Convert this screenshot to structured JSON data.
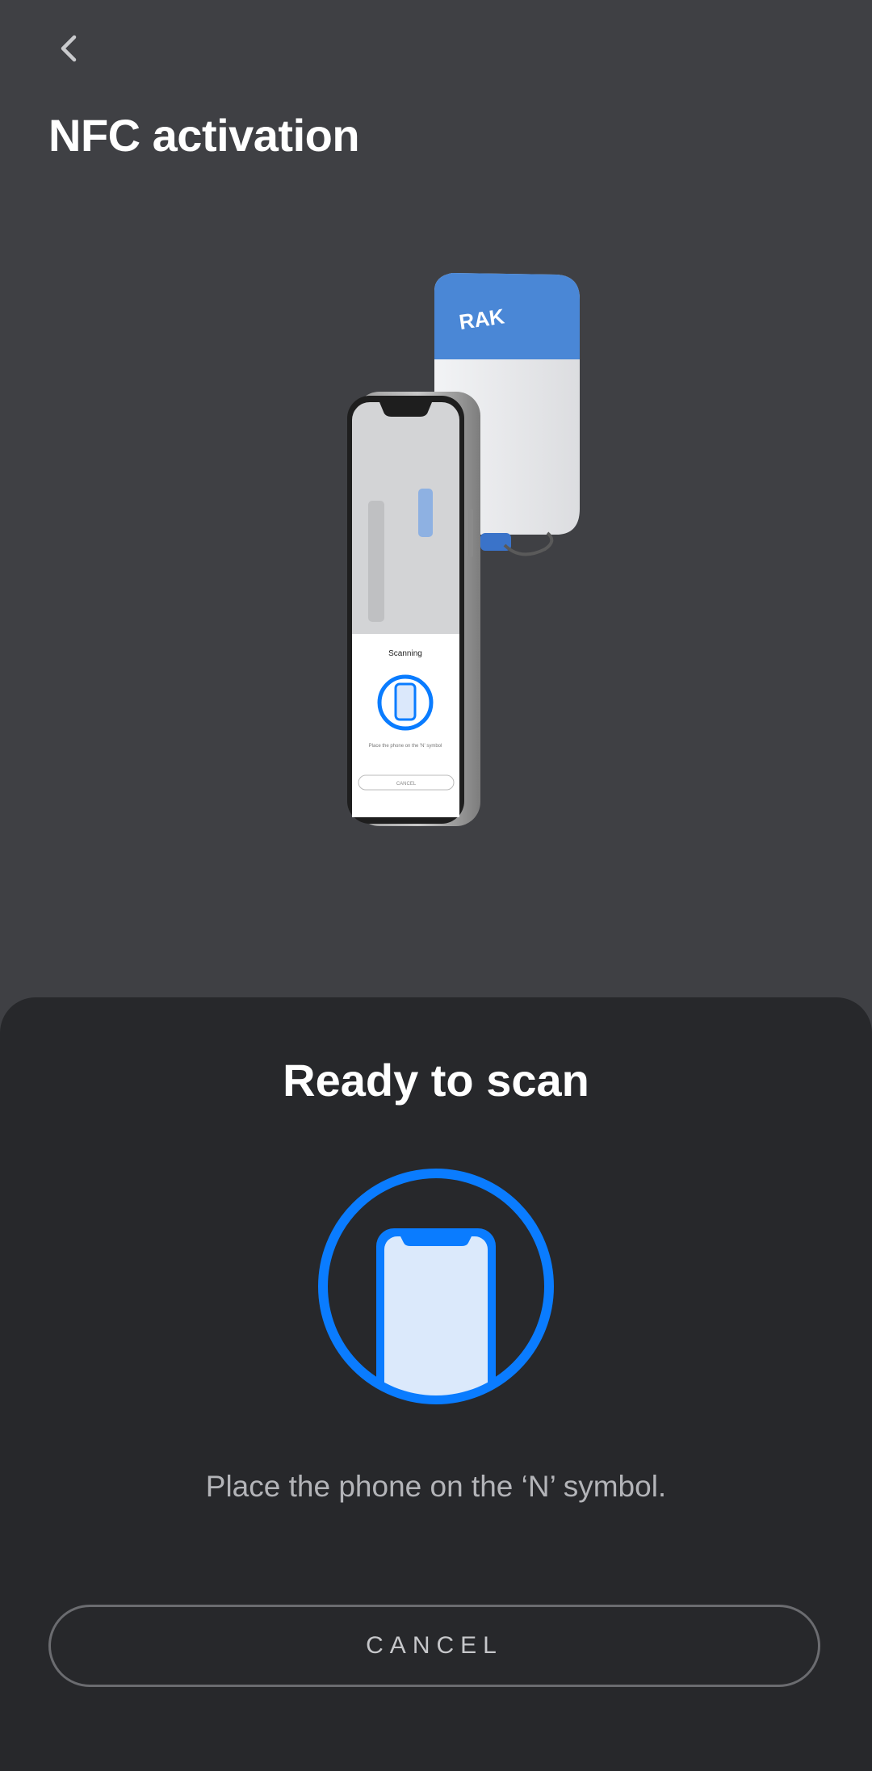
{
  "header": {
    "back_icon": "chevron-left-icon",
    "title": "NFC activation"
  },
  "illustration": {
    "device_brand": "RAK",
    "mini_screen_title": "Scanning",
    "mini_screen_instruction": "Place the phone on the 'N' symbol",
    "mini_screen_cancel": "CANCEL"
  },
  "sheet": {
    "title": "Ready to scan",
    "scan_icon": "phone-scan-icon",
    "instruction": "Place the phone on the ‘N’ symbol.",
    "cancel_label": "CANCEL"
  },
  "colors": {
    "page_bg": "#3f4044",
    "sheet_bg": "#27282b",
    "accent": "#0a7cff",
    "device_blue": "#4a87d6"
  }
}
